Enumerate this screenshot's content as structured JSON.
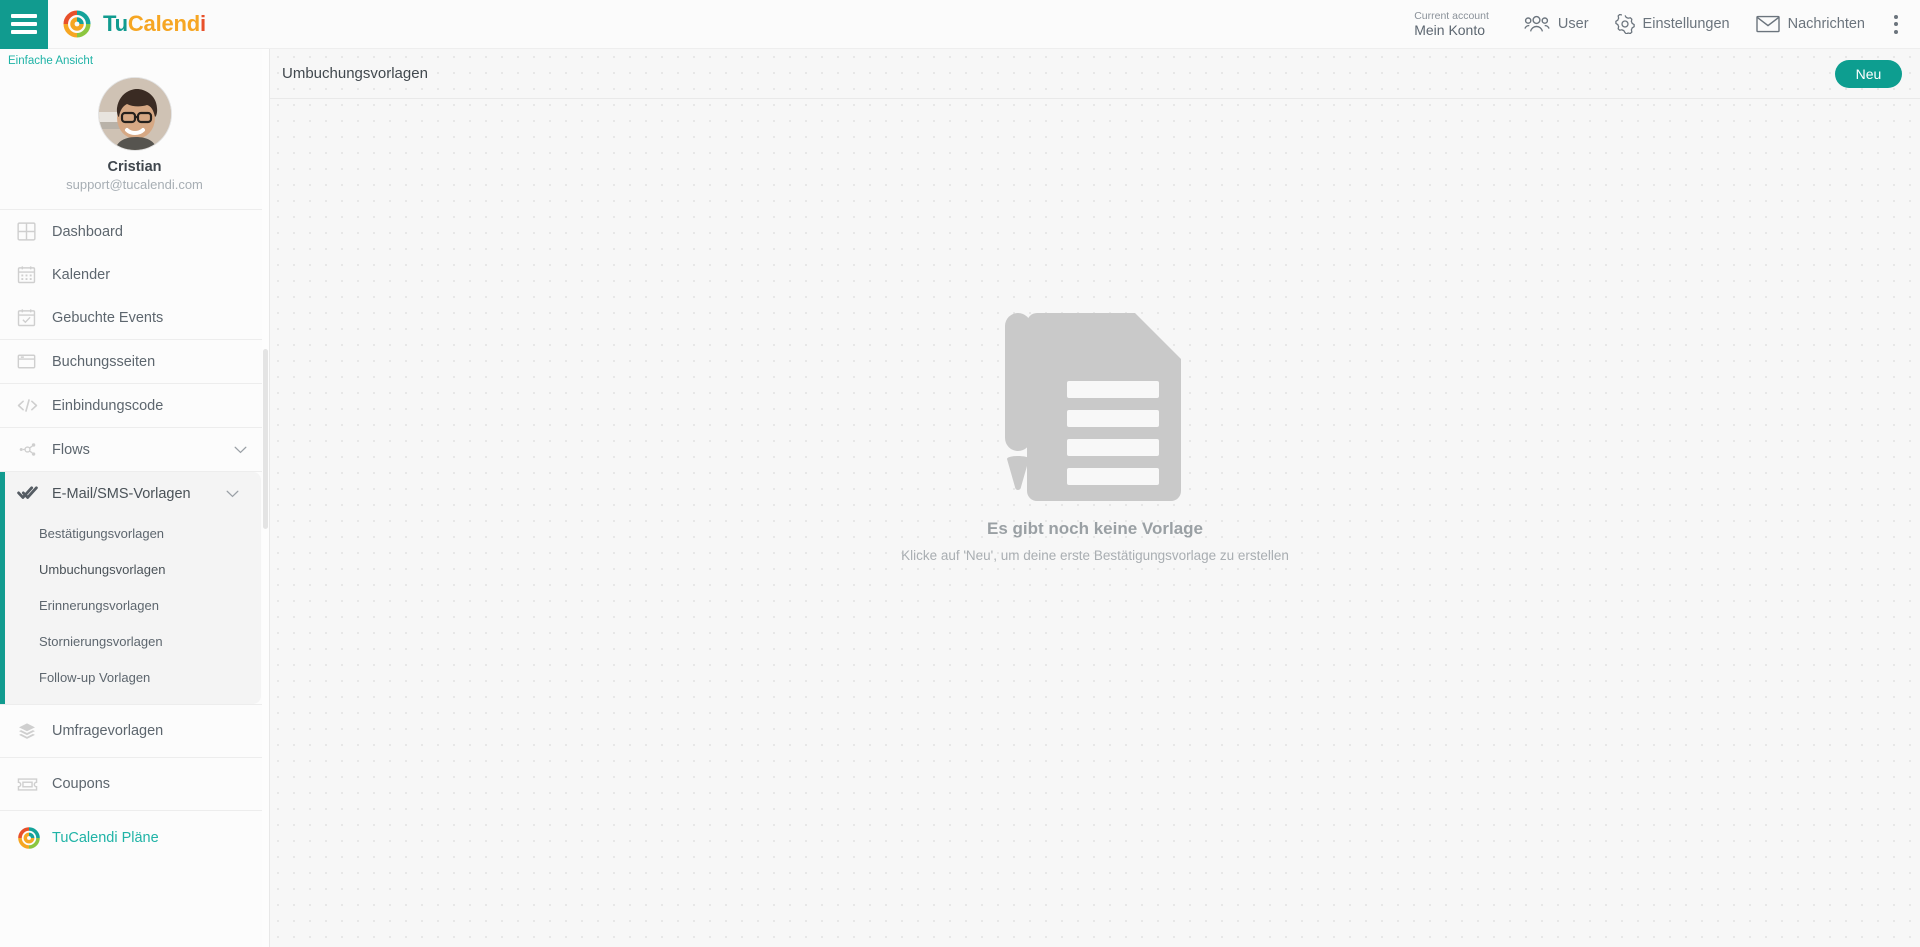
{
  "topbar": {
    "menu_icon": "hamburger-icon",
    "brand": {
      "part1": "Tu",
      "part2": "Calend",
      "part3": "i",
      "logo_icon": "tucalendi-logo-icon"
    },
    "account": {
      "label": "Current account",
      "value": "Mein Konto"
    },
    "items": [
      {
        "label": "User",
        "icon": "users-icon"
      },
      {
        "label": "Einstellungen",
        "icon": "gear-icon"
      },
      {
        "label": "Nachrichten",
        "icon": "envelope-icon"
      }
    ],
    "overflow_icon": "kebab-menu-icon"
  },
  "sidebar": {
    "simple_view": "Einfache Ansicht",
    "profile": {
      "name": "Cristian",
      "email": "support@tucalendi.com",
      "avatar_icon": "user-avatar"
    },
    "groups": [
      {
        "items": [
          {
            "label": "Dashboard",
            "icon": "dashboard-grid-icon"
          },
          {
            "label": "Kalender",
            "icon": "calendar-icon"
          },
          {
            "label": "Gebuchte Events",
            "icon": "calendar-check-icon"
          }
        ]
      },
      {
        "items": [
          {
            "label": "Buchungsseiten",
            "icon": "browser-window-icon"
          }
        ]
      },
      {
        "items": [
          {
            "label": "Einbindungscode",
            "icon": "code-brackets-icon"
          }
        ]
      },
      {
        "items": [
          {
            "label": "Flows",
            "icon": "flow-nodes-icon",
            "expandable": true
          }
        ]
      }
    ],
    "active_section": {
      "label": "E-Mail/SMS-Vorlagen",
      "icon": "double-check-icon",
      "chevron": "chevron-down-icon",
      "sub_items": [
        {
          "label": "Bestätigungsvorlagen"
        },
        {
          "label": "Umbuchungsvorlagen",
          "selected": true
        },
        {
          "label": "Erinnerungsvorlagen"
        },
        {
          "label": "Stornierungsvorlagen"
        },
        {
          "label": "Follow-up Vorlagen"
        }
      ]
    },
    "groups_after": [
      {
        "items": [
          {
            "label": "Umfragevorlagen",
            "icon": "layers-icon"
          }
        ]
      },
      {
        "items": [
          {
            "label": "Coupons",
            "icon": "ticket-icon"
          }
        ]
      }
    ],
    "plans": {
      "label": "TuCalendi Pläne",
      "icon": "tucalendi-logo-icon"
    }
  },
  "main": {
    "title": "Umbuchungsvorlagen",
    "new_button": "Neu",
    "empty_state": {
      "icon": "document-pencil-icon",
      "title": "Es gibt noch keine Vorlage",
      "subtitle": "Klicke auf 'Neu', um deine erste Bestätigungsvorlage zu erstellen"
    }
  },
  "colors": {
    "brand_teal": "#119b8f",
    "brand_teal_light": "#1fb3a6",
    "brand_orange": "#f6a623",
    "brand_red": "#e8502a",
    "brand_green": "#8cc63f"
  }
}
